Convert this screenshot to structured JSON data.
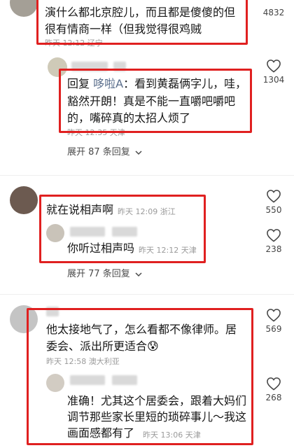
{
  "comment1": {
    "text_line1": "演什么都北京腔儿，而且都是傻傻的但",
    "text_line2": "很有情商一样（但我觉得很鸡贼",
    "meta": "昨天 12:12 辽宁",
    "likes": "4832",
    "reply": {
      "prefix": "回复",
      "mention": "哆啦A",
      "line1_rest": "：看到黄磊俩字儿，哇，",
      "line2": "豁然开朗！真是不能一直嚼吧嚼吧",
      "line3": "的，嘴碎真的太招人烦了",
      "meta": "昨天 12:35 天津",
      "likes": "1304"
    },
    "expand": "展开 87 条回复"
  },
  "comment2": {
    "text": "就在说相声啊",
    "meta": "昨天 12:09 浙江",
    "likes": "550",
    "reply": {
      "text": "你听过相声吗",
      "meta": "昨天 12:12 天津",
      "likes": "238"
    },
    "expand": "展开 77 条回复"
  },
  "comment3": {
    "text_line1": "他太接地气了，怎么看都不像律师。居",
    "text_line2": "委会、派出所更适合",
    "emoji": "😰",
    "meta": "昨天 12:58 澳大利亚",
    "likes": "569",
    "reply": {
      "line1": "准确！尤其这个居委会，跟着大妈们",
      "line2": "调节那些家长里短的琐碎事儿～我这",
      "line3": "画面感都有了",
      "meta": "昨天 13:06 天津",
      "likes": "268"
    }
  },
  "icons": {
    "like": "heart-outline-icon"
  },
  "colors": {
    "highlight_box": "#e02020",
    "mention": "#5a6e8c"
  }
}
